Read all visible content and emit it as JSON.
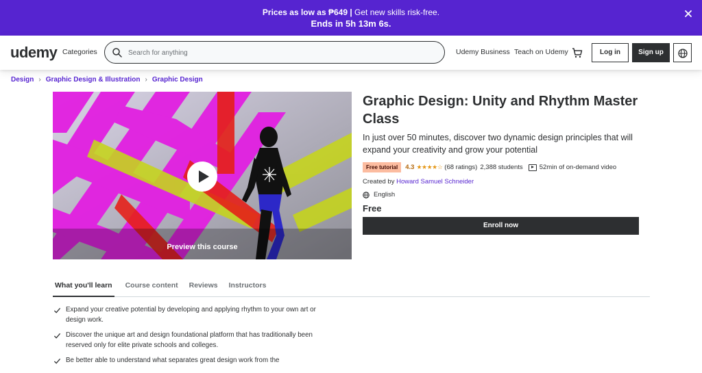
{
  "banner": {
    "line1_bold": "Prices as low as ₱649 |",
    "line1_rest": " Get new skills risk-free.",
    "line2": "Ends in 5h 13m 6s.",
    "bg_color": "#5624d0"
  },
  "header": {
    "logo": "udemy",
    "categories": "Categories",
    "search_placeholder": "Search for anything",
    "business": "Udemy Business",
    "teach": "Teach on Udemy",
    "login": "Log in",
    "signup": "Sign up"
  },
  "breadcrumb": [
    "Design",
    "Graphic Design & Illustration",
    "Graphic Design"
  ],
  "video": {
    "preview_label": "Preview this course"
  },
  "course": {
    "title": "Graphic Design: Unity and Rhythm Master Class",
    "subtitle": "In just over 50 minutes, discover two dynamic design principles that will expand your creativity and grow your potential",
    "badge": "Free tutorial",
    "rating": "4.3",
    "stars": "★★★★☆",
    "ratings_count": "(68 ratings)",
    "students": "2,388 students",
    "video_length": "52min of on-demand video",
    "created_by_label": "Created by ",
    "instructor": "Howard Samuel Schneider",
    "language": "English",
    "price": "Free",
    "enroll": "Enroll now"
  },
  "tabs": [
    "What you'll learn",
    "Course content",
    "Reviews",
    "Instructors"
  ],
  "learn_items": [
    "Expand your creative potential by developing and applying rhythm to your own art or design work.",
    "Discover the unique art and design foundational platform that has traditionally been reserved only for elite private schools and colleges.",
    "Be better able to understand what separates great design work from the"
  ],
  "colors": {
    "accent": "#5624d0",
    "logo_accent": "#a435f0",
    "dark": "#2d2f31",
    "rating": "#b4690e",
    "badge_bg": "#fcbca0"
  }
}
